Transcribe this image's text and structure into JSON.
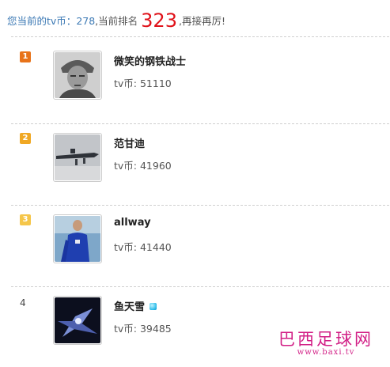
{
  "summary": {
    "coin_label": "您当前的tv币：",
    "coin_value": "278",
    "rank_label": ",当前排名",
    "rank_value": "323",
    "suffix": ",再接再厉!"
  },
  "ranking": {
    "entries": [
      {
        "rank": "1",
        "name": "微笑的钢铁战士",
        "coins_label": "tv币: ",
        "coins": "51110",
        "badge_color": "#e8731a"
      },
      {
        "rank": "2",
        "name": "范甘迪",
        "coins_label": "tv币: ",
        "coins": "41960",
        "badge_color": "#f0a824"
      },
      {
        "rank": "3",
        "name": "allway",
        "coins_label": "tv币: ",
        "coins": "41440",
        "badge_color": "#f5c64a"
      },
      {
        "rank": "4",
        "name": "鱼天雪",
        "coins_label": "tv币: ",
        "coins": "39485",
        "badge_color": ""
      }
    ]
  },
  "watermark": {
    "text_cn": "巴西足球网",
    "text_url": "www.baxi.tv"
  },
  "colors": {
    "link_blue": "#3d7ab5",
    "rank_red": "#e0121a",
    "watermark_magenta": "#d21f86",
    "vip_icon": "#29b9e8"
  }
}
